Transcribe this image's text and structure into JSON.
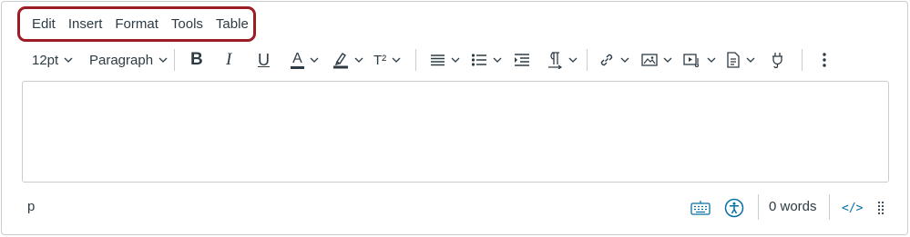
{
  "menubar": {
    "items": [
      "Edit",
      "Insert",
      "Format",
      "Tools",
      "Table"
    ]
  },
  "toolbar": {
    "font_size": "12pt",
    "block_format": "Paragraph",
    "bold_label": "B",
    "italic_label": "I",
    "underline_label": "U",
    "text_color_label": "A",
    "superscript_label": "T²"
  },
  "statusbar": {
    "path": "p",
    "word_count": "0 words",
    "html_editor_label": "</>"
  },
  "colors": {
    "accent": "#0770a3",
    "highlight_box": "#9b1c24",
    "text_color_bar": "#2d3b45"
  }
}
